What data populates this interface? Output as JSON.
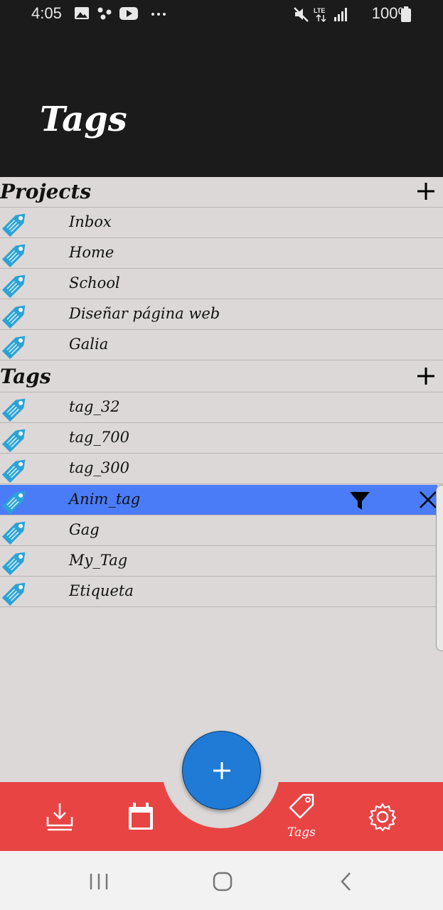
{
  "status_bar": {
    "time": "4:05",
    "battery": "100%",
    "icons": [
      "gallery-icon",
      "dots-icon",
      "youtube-icon",
      "more-icon",
      "mute-icon",
      "lte-icon",
      "signal-icon",
      "battery-icon"
    ]
  },
  "header": {
    "title": "Tags"
  },
  "projects": {
    "title": "Projects",
    "items": [
      {
        "label": "Inbox"
      },
      {
        "label": "Home"
      },
      {
        "label": "School"
      },
      {
        "label": "Diseñar página web"
      },
      {
        "label": "Galia"
      }
    ]
  },
  "tags": {
    "title": "Tags",
    "items": [
      {
        "label": "tag_32"
      },
      {
        "label": "tag_700"
      },
      {
        "label": "tag_300"
      },
      {
        "label": "Anim_tag",
        "selected": true
      },
      {
        "label": "Gag"
      },
      {
        "label": "My_Tag"
      },
      {
        "label": "Etiqueta"
      }
    ]
  },
  "bottom_nav": {
    "items": [
      {
        "icon": "inbox-download-icon"
      },
      {
        "icon": "calendar-icon"
      },
      {
        "icon": "tag-icon",
        "label": "Tags",
        "active": true
      },
      {
        "icon": "settings-gear-icon"
      }
    ],
    "fab_icon": "plus-icon"
  },
  "colors": {
    "header_bg": "#1c1b1b",
    "list_bg": "#dcd8d8",
    "selected_row": "#4a7cf7",
    "bottom_bar": "#e84444",
    "fab": "#1f7bd6",
    "tag_icon": "#2ba3d6"
  }
}
